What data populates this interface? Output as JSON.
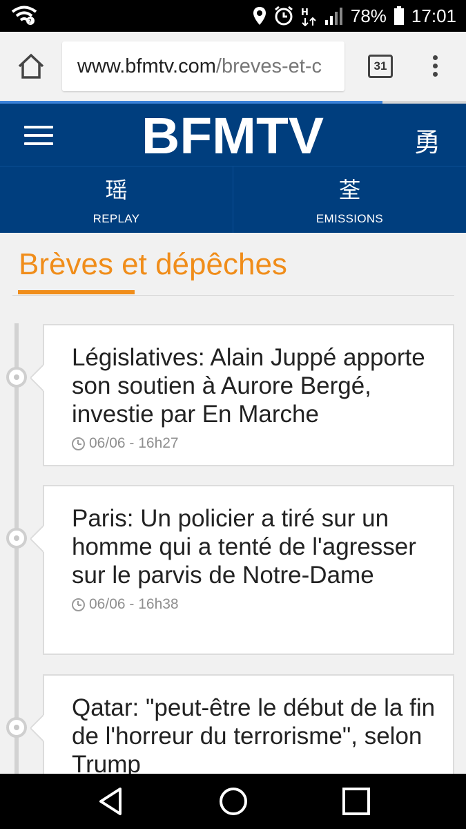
{
  "status_bar": {
    "battery": "78%",
    "time": "17:01"
  },
  "browser": {
    "url_host": "www.bfmtv.com",
    "url_path": "/breves-et-c",
    "tab_count": "31",
    "progress": 0.82
  },
  "site": {
    "logo_text": "BFMTV",
    "header_icon": "勇",
    "nav": [
      {
        "icon": "瑶",
        "label": "REPLAY"
      },
      {
        "icon": "荃",
        "label": "EMISSIONS"
      }
    ]
  },
  "page": {
    "title": "Brèves et dépêches"
  },
  "articles": [
    {
      "title": "Législatives: Alain Juppé apporte son soutien à Aurore Bergé, investie par En Marche",
      "time": "06/06 - 16h27"
    },
    {
      "title": "Paris:  Un policier a tiré sur un homme qui a tenté de l'agresser sur le parvis de Notre-Dame",
      "time": "06/06 - 16h38"
    },
    {
      "title": "Qatar: \"peut-être le début de la fin de l'horreur du terrorisme\", selon Trump",
      "time": ""
    }
  ],
  "colors": {
    "brand_blue": "#003e7e",
    "accent_orange": "#f08d1a"
  }
}
